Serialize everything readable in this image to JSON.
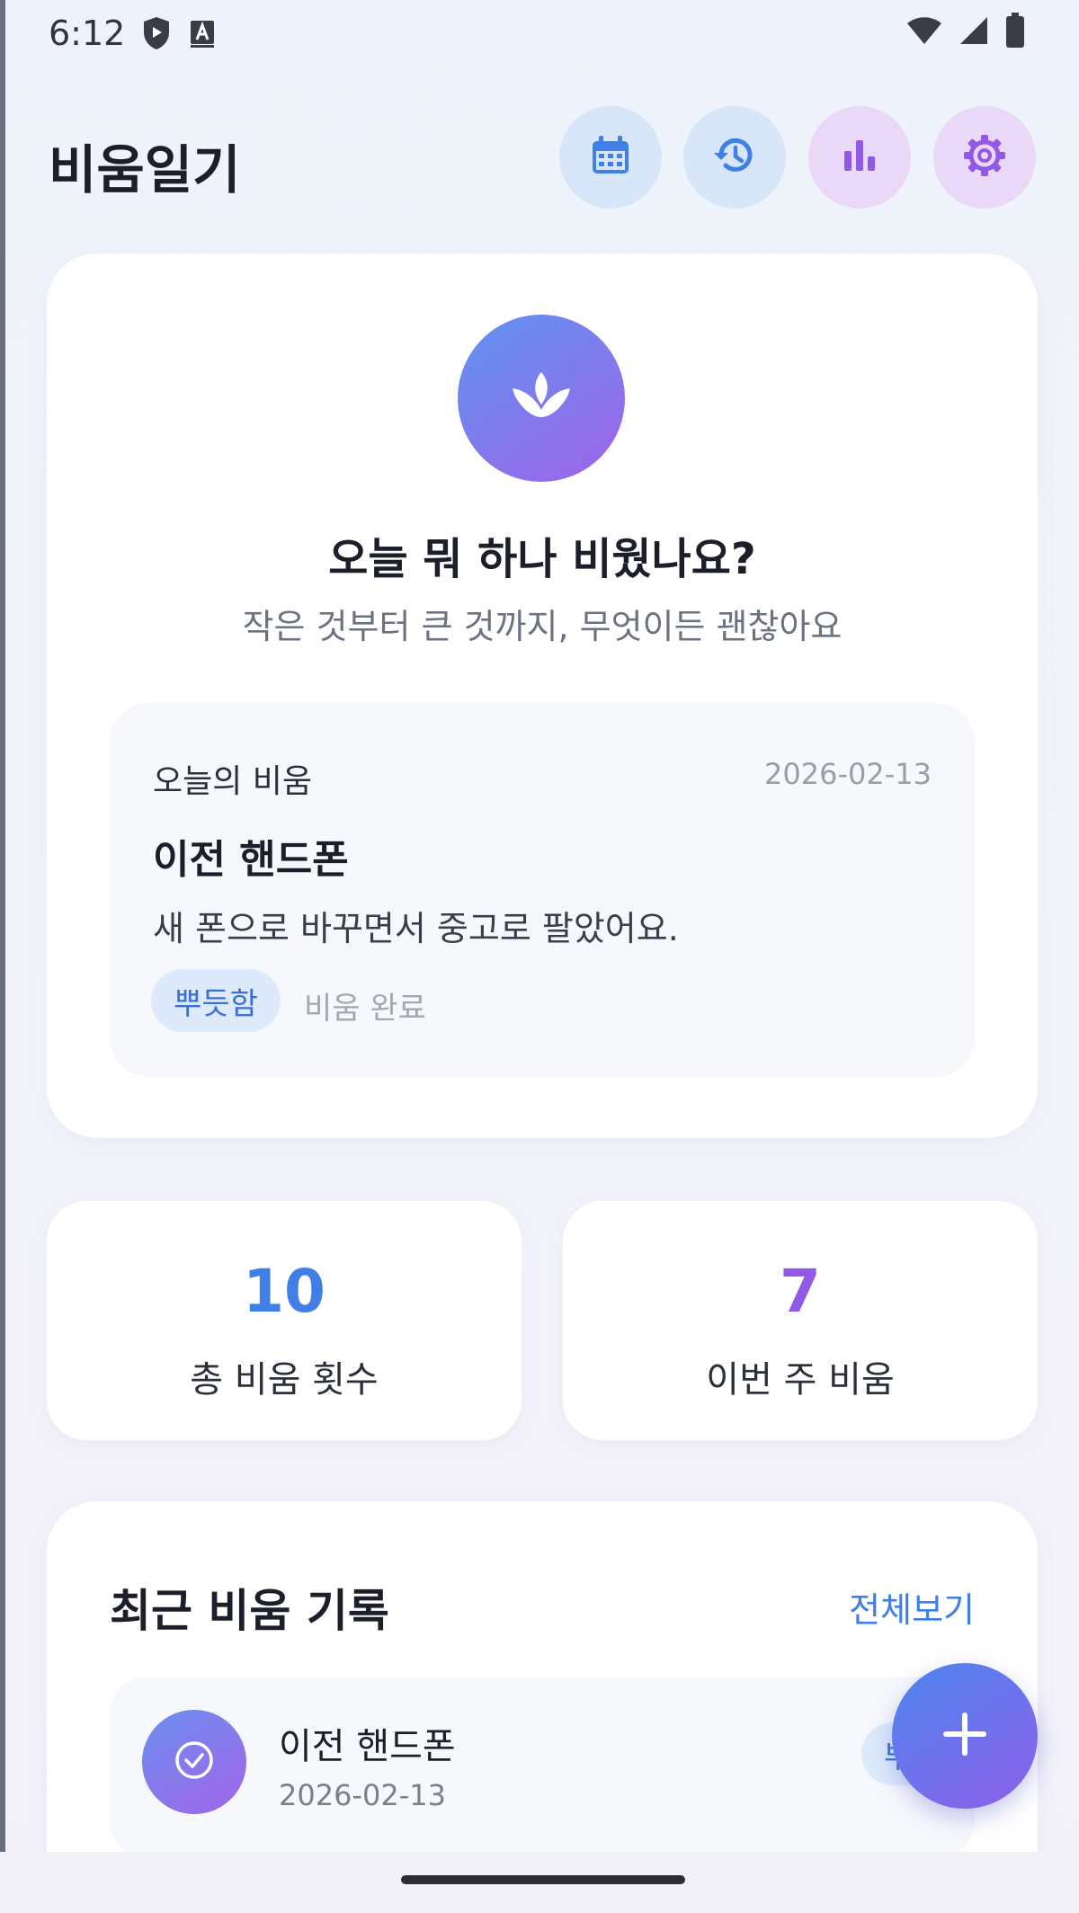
{
  "status_bar": {
    "time": "6:12"
  },
  "header": {
    "title": "비움일기"
  },
  "hero": {
    "question": "오늘 뭐 하나 비웠나요?",
    "subtitle": "작은 것부터 큰 것까지, 무엇이든 괜찮아요"
  },
  "today": {
    "label": "오늘의 비움",
    "date": "2026-02-13",
    "title": "이전 핸드폰",
    "description": "새 폰으로 바꾸면서 중고로 팔았어요.",
    "tag": "뿌듯함",
    "status": "비움 완료"
  },
  "stats": [
    {
      "value": "10",
      "label": "총 비움 횟수"
    },
    {
      "value": "7",
      "label": "이번 주 비움"
    }
  ],
  "recent": {
    "title": "최근 비움 기록",
    "view_all": "전체보기",
    "items": [
      {
        "title": "이전 핸드폰",
        "date": "2026-02-13",
        "tag": "뿌듯함"
      }
    ]
  },
  "colors": {
    "accent_blue": "#3f7fe6",
    "accent_purple": "#9258e6",
    "chip_bg": "#ddeafb"
  },
  "icons": {
    "header": [
      "calendar-icon",
      "history-icon",
      "bar-chart-icon",
      "settings-icon"
    ],
    "hero": "sprout-icon",
    "recent_item": "check-circle-icon",
    "fab": "plus-icon"
  }
}
